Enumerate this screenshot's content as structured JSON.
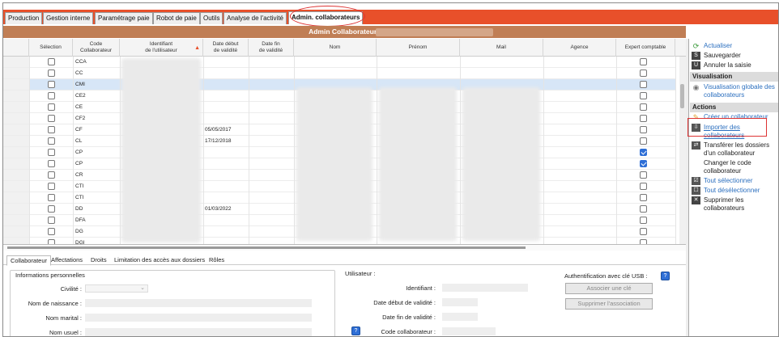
{
  "tabs": [
    "Production",
    "Gestion interne",
    "Paramétrage paie",
    "Robot de paie",
    "Outils",
    "Analyse de l'activité",
    "Admin. collaborateurs"
  ],
  "title": "Admin Collaborateurs",
  "columns": {
    "selection": "Sélection",
    "code1": "Code",
    "code2": "Collaborateur",
    "ident1": "Identifiant",
    "ident2": "de l'utilisateur",
    "start1": "Date début",
    "start2": "de validité",
    "end1": "Date fin",
    "end2": "de validité",
    "nom": "Nom",
    "prenom": "Prénom",
    "mail": "Mail",
    "agence": "Agence",
    "expert": "Expert comptable"
  },
  "rows": [
    {
      "code": "CCA",
      "start": "",
      "expert": false,
      "selected": false
    },
    {
      "code": "CC",
      "start": "",
      "expert": false,
      "selected": false
    },
    {
      "code": "CMI",
      "start": "",
      "expert": false,
      "selected": true
    },
    {
      "code": "CE2",
      "start": "",
      "expert": false,
      "selected": false
    },
    {
      "code": "CE",
      "start": "",
      "expert": false,
      "selected": false
    },
    {
      "code": "CF2",
      "start": "",
      "expert": false,
      "selected": false
    },
    {
      "code": "CF",
      "start": "05/05/2017",
      "expert": false,
      "selected": false
    },
    {
      "code": "CL",
      "start": "17/12/2018",
      "expert": false,
      "selected": false
    },
    {
      "code": "CP",
      "start": "",
      "expert": true,
      "selected": false
    },
    {
      "code": "CP",
      "start": "",
      "expert": true,
      "selected": false
    },
    {
      "code": "CR",
      "start": "",
      "expert": false,
      "selected": false
    },
    {
      "code": "CTI",
      "start": "",
      "expert": false,
      "selected": false
    },
    {
      "code": "CTI",
      "start": "",
      "expert": false,
      "selected": false
    },
    {
      "code": "DD",
      "start": "01/03/2022",
      "expert": false,
      "selected": false
    },
    {
      "code": "DFA",
      "start": "",
      "expert": false,
      "selected": false
    },
    {
      "code": "DG",
      "start": "",
      "expert": false,
      "selected": false
    },
    {
      "code": "DGI",
      "start": "",
      "expert": false,
      "selected": false
    }
  ],
  "right_panel": {
    "actualiser": "Actualiser",
    "sauvegarder": "Sauvegarder",
    "annuler": "Annuler la saisie",
    "visualisation_head": "Visualisation",
    "visualisation_globale": "Visualisation globale des collaborateurs",
    "actions_head": "Actions",
    "creer": "Créer un collaborateur",
    "importer": "Importer des collaborateurs",
    "transferer": "Transférer les dossiers d'un collaborateur",
    "changer": "Changer le code collaborateur",
    "tout_sel": "Tout sélectionner",
    "tout_desel": "Tout désélectionner",
    "supprimer": "Supprimer les collaborateurs"
  },
  "bottom_tabs": [
    "Collaborateur",
    "Affectations",
    "Droits",
    "Limitation des accès aux dossiers",
    "Rôles"
  ],
  "info_perso": {
    "title": "Informations personnelles",
    "civilite": "Civilité :",
    "nom_naissance": "Nom de naissance :",
    "nom_marital": "Nom marital :",
    "nom_usuel": "Nom usuel :"
  },
  "utilisateur": {
    "title": "Utilisateur :",
    "identifiant": "Identifiant :",
    "date_debut": "Date début de validité :",
    "date_fin": "Date fin de validité :",
    "code_collab": "Code collaborateur :"
  },
  "usb": {
    "title": "Authentification avec clé USB :",
    "associer": "Associer une clé",
    "supprimer": "Supprimer l'association"
  }
}
